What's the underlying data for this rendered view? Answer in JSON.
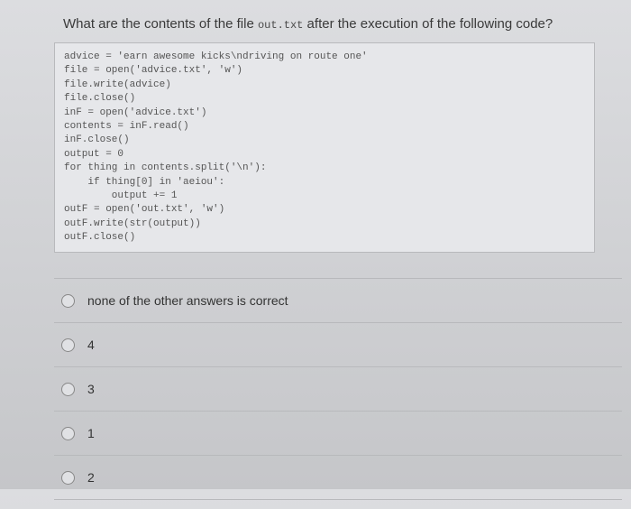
{
  "question": {
    "prefix": "What are the contents of the file ",
    "filename": "out.txt",
    "suffix": " after the execution of the following code?"
  },
  "code": "advice = 'earn awesome kicks\\ndriving on route one'\nfile = open('advice.txt', 'w')\nfile.write(advice)\nfile.close()\ninF = open('advice.txt')\ncontents = inF.read()\ninF.close()\noutput = 0\nfor thing in contents.split('\\n'):\n    if thing[0] in 'aeiou':\n        output += 1\noutF = open('out.txt', 'w')\noutF.write(str(output))\noutF.close()",
  "answers": [
    {
      "label": "none of the other answers is correct"
    },
    {
      "label": "4"
    },
    {
      "label": "3"
    },
    {
      "label": "1"
    },
    {
      "label": "2"
    }
  ]
}
